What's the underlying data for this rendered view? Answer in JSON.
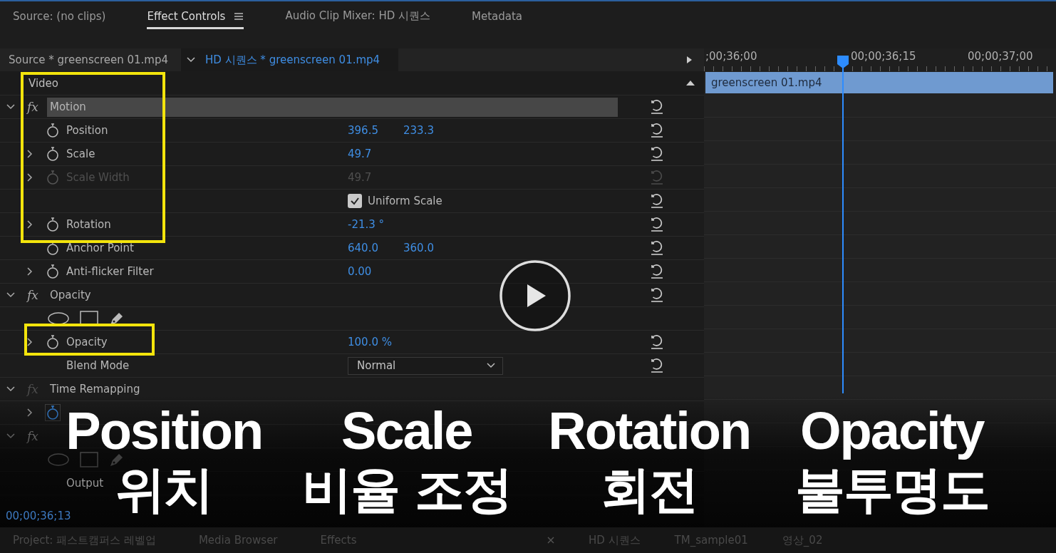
{
  "panel_tabs": [
    {
      "label": "Source: (no clips)",
      "selected": false,
      "menu": false
    },
    {
      "label": "Effect Controls",
      "selected": true,
      "menu": true
    },
    {
      "label": "Audio Clip Mixer: HD 시퀀스",
      "selected": false,
      "menu": false
    },
    {
      "label": "Metadata",
      "selected": false,
      "menu": false
    }
  ],
  "clip_header": {
    "source": "Source * greenscreen 01.mp4",
    "sequence": "HD 시퀀스 * greenscreen 01.mp4"
  },
  "section": "Video",
  "rows": [
    {
      "kind": "effect",
      "icon": "fx",
      "name": "Motion",
      "highlighted": true,
      "disabled": false,
      "reset": true
    },
    {
      "kind": "property",
      "name": "Position",
      "values": [
        "396.5",
        "233.3"
      ],
      "expandable": false,
      "disabled": false,
      "reset": true
    },
    {
      "kind": "property",
      "name": "Scale",
      "values": [
        "49.7"
      ],
      "expandable": true,
      "disabled": false,
      "reset": true
    },
    {
      "kind": "property",
      "name": "Scale Width",
      "values": [
        "49.7"
      ],
      "expandable": true,
      "disabled": true,
      "reset": true
    },
    {
      "kind": "checkbox",
      "label": "Uniform Scale",
      "checked": true,
      "reset": true
    },
    {
      "kind": "property",
      "name": "Rotation",
      "values": [
        "-21.3 °"
      ],
      "expandable": true,
      "disabled": false,
      "reset": true
    },
    {
      "kind": "property",
      "name": "Anchor Point",
      "values": [
        "640.0",
        "360.0"
      ],
      "expandable": false,
      "disabled": false,
      "reset": true
    },
    {
      "kind": "property",
      "name": "Anti-flicker Filter",
      "values": [
        "0.00"
      ],
      "expandable": true,
      "disabled": false,
      "reset": true
    },
    {
      "kind": "effect",
      "icon": "fx",
      "name": "Opacity",
      "highlighted": false,
      "disabled": false,
      "reset": true
    },
    {
      "kind": "masks",
      "reset": false
    },
    {
      "kind": "property",
      "name": "Opacity",
      "values": [
        "100.0 %"
      ],
      "expandable": true,
      "disabled": false,
      "reset": true
    },
    {
      "kind": "dropdown",
      "name": "Blend Mode",
      "value": "Normal",
      "reset": true
    },
    {
      "kind": "effect",
      "icon": "fx",
      "name": "Time Remapping",
      "highlighted": false,
      "disabled": true,
      "reset": false
    },
    {
      "kind": "property",
      "values": [],
      "expandable": true,
      "animated": true,
      "reset": false
    },
    {
      "kind": "effect",
      "icon": "fx",
      "disabled": false,
      "reset": false
    },
    {
      "kind": "masks",
      "reset": false
    },
    {
      "kind": "property",
      "name": "Output",
      "values": [],
      "expandable": false,
      "no_stopwatch": true,
      "reset": false
    }
  ],
  "timecode": "00;00;36;13",
  "timeline": {
    "ruler": [
      ";00;36;00",
      "00;00;36;15",
      "00;00;37;00"
    ],
    "clip": "greenscreen 01.mp4"
  },
  "bottom_tabs_left": [
    "Project: 패스트캠퍼스 레벨업",
    "Media Browser",
    "Effects"
  ],
  "bottom_tabs_right": [
    "HD 시퀀스",
    "TM_sample01",
    "영상_02"
  ],
  "captions": [
    {
      "english": "Position",
      "korean": "위치"
    },
    {
      "english": "Scale",
      "korean": "비율 조정"
    },
    {
      "english": "Rotation",
      "korean": "회전"
    },
    {
      "english": "Opacity",
      "korean": "불투명도"
    }
  ]
}
